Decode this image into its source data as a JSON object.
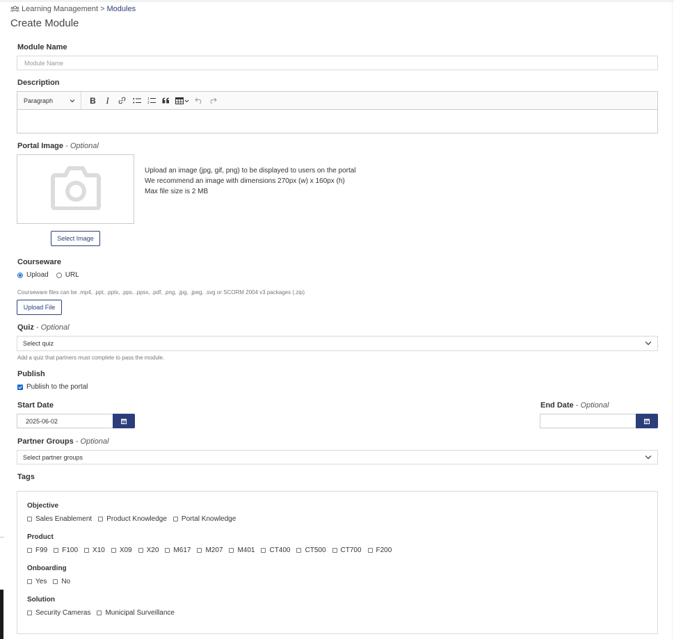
{
  "breadcrumb": {
    "icon": "users-icon",
    "root": "Learning Management",
    "separator": ">",
    "current": "Modules"
  },
  "page_title": "Create Module",
  "module_name": {
    "label": "Module Name",
    "placeholder": "Module Name",
    "value": ""
  },
  "description": {
    "label": "Description",
    "paragraph_select": "Paragraph",
    "toolbar_icons": [
      "bold-icon",
      "italic-icon",
      "link-icon",
      "bulleted-list-icon",
      "numbered-list-icon",
      "block-quote-icon",
      "insert-table-icon",
      "undo-icon",
      "redo-icon"
    ],
    "toolbar_glyphs": {
      "bold": "B",
      "italic": "I"
    }
  },
  "portal_image": {
    "label": "Portal Image",
    "optional": "- Optional",
    "placeholder_icon": "camera-icon",
    "help_lines": [
      "Upload an image (jpg, gif, png) to be displayed to users on the portal",
      "We recommend an image with dimensions 270px (w) x 160px (h)",
      "Max file size is 2 MB"
    ],
    "select_button": "Select Image"
  },
  "courseware": {
    "label": "Courseware",
    "options": [
      "Upload",
      "URL"
    ],
    "selected": "Upload",
    "help": "Courseware files can be .mp4, .ppt, .pptx, .pps, .ppsx, .pdf, .png, .jpg, .jpeg, .svg or SCORM 2004 v3 packages (.zip)",
    "upload_button": "Upload File"
  },
  "quiz": {
    "label": "Quiz",
    "optional": "- Optional",
    "placeholder": "Select quiz",
    "help": "Add a quiz that partners must complete to pass the module."
  },
  "publish": {
    "label": "Publish",
    "checkbox_label": "Publish to the portal",
    "checked": true
  },
  "start_date": {
    "label": "Start Date",
    "value": "2025-06-02"
  },
  "end_date": {
    "label": "End Date",
    "optional": "- Optional",
    "value": ""
  },
  "partner_groups": {
    "label": "Partner Groups",
    "optional": "- Optional",
    "placeholder": "Select partner groups"
  },
  "tags": {
    "label": "Tags",
    "groups": [
      {
        "title": "Objective",
        "items": [
          "Sales Enablement",
          "Product Knowledge",
          "Portal Knowledge"
        ]
      },
      {
        "title": "Product",
        "items": [
          "F99",
          "F100",
          "X10",
          "X09",
          "X20",
          "M617",
          "M207",
          "M401",
          "CT400",
          "CT500",
          "CT700",
          "F200"
        ]
      },
      {
        "title": "Onboarding",
        "items": [
          "Yes",
          "No"
        ]
      },
      {
        "title": "Solution",
        "items": [
          "Security Cameras",
          "Municipal Surveillance"
        ]
      }
    ]
  },
  "colors": {
    "primary": "#2c3e7a",
    "checkbox_accent": "#1a6fd1",
    "border": "#d7d9de"
  }
}
